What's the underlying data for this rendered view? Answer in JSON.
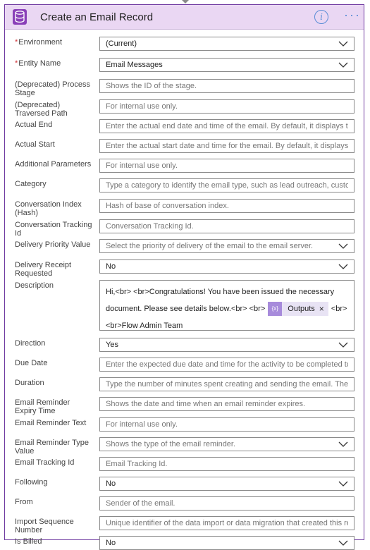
{
  "card": {
    "title": "Create an Email Record",
    "icon": "database-icon",
    "accent": "#6f3aa0",
    "header_bg": "#ead7f3"
  },
  "fields": [
    {
      "label": "Environment",
      "required": true,
      "value": "(Current)",
      "type": "dropdown"
    },
    {
      "label": "Entity Name",
      "required": true,
      "value": "Email Messages",
      "type": "dropdown"
    },
    {
      "label": "(Deprecated) Process Stage",
      "placeholder": "Shows the ID of the stage.",
      "type": "text"
    },
    {
      "label": "(Deprecated) Traversed Path",
      "placeholder": "For internal use only.",
      "type": "text"
    },
    {
      "label": "Actual End",
      "placeholder": "Enter the actual end date and time of the email. By default, it displays the dat",
      "type": "text"
    },
    {
      "label": "Actual Start",
      "placeholder": "Enter the actual start date and time for the email. By default, it displays the da",
      "type": "text"
    },
    {
      "label": "Additional Parameters",
      "placeholder": "For internal use only.",
      "type": "text"
    },
    {
      "label": "Category",
      "placeholder": "Type a category to identify the email type, such as lead outreach, customer fo",
      "type": "text"
    },
    {
      "label": "Conversation Index (Hash)",
      "placeholder": "Hash of base of conversation index.",
      "type": "text"
    },
    {
      "label": "Conversation Tracking Id",
      "placeholder": "Conversation Tracking Id.",
      "type": "text"
    },
    {
      "label": "Delivery Priority Value",
      "placeholder": "Select the priority of delivery of the email to the email server.",
      "type": "dropdown"
    },
    {
      "label": "Delivery Receipt Requested",
      "value": "No",
      "type": "dropdown"
    },
    {
      "label": "Description",
      "type": "rich"
    },
    {
      "label": "Direction",
      "value": "Yes",
      "type": "dropdown"
    },
    {
      "label": "Due Date",
      "placeholder": "Enter the expected due date and time for the activity to be completed to prov",
      "type": "text"
    },
    {
      "label": "Duration",
      "placeholder": "Type the number of minutes spent creating and sending the email. The durati",
      "type": "text"
    },
    {
      "label": "Email Reminder Expiry Time",
      "placeholder": "Shows the date and time when an email reminder expires.",
      "type": "text"
    },
    {
      "label": "Email Reminder Text",
      "placeholder": "For internal use only.",
      "type": "text"
    },
    {
      "label": "Email Reminder Type Value",
      "placeholder": "Shows the type of the email reminder.",
      "type": "dropdown"
    },
    {
      "label": "Email Tracking Id",
      "placeholder": "Email Tracking Id.",
      "type": "text"
    },
    {
      "label": "Following",
      "value": "No",
      "type": "dropdown"
    },
    {
      "label": "From",
      "placeholder": "Sender of the email.",
      "type": "text"
    },
    {
      "label": "Import Sequence Number",
      "placeholder": "Unique identifier of the data import or data migration that created this record",
      "type": "text"
    },
    {
      "label": "Is Billed",
      "value": "No",
      "type": "dropdown"
    }
  ],
  "description": {
    "line1": "Hi,<br> <br>Congratulations! You have been issued the necessary",
    "line2_before": "document. Please see details below.<br> <br>",
    "token_label": "Outputs",
    "token_icon": "expression-icon",
    "token_close": "×",
    "line2_after": "<br>",
    "line3": "<br>Flow Admin Team"
  },
  "header_icons": {
    "info": "i",
    "more": "···"
  }
}
